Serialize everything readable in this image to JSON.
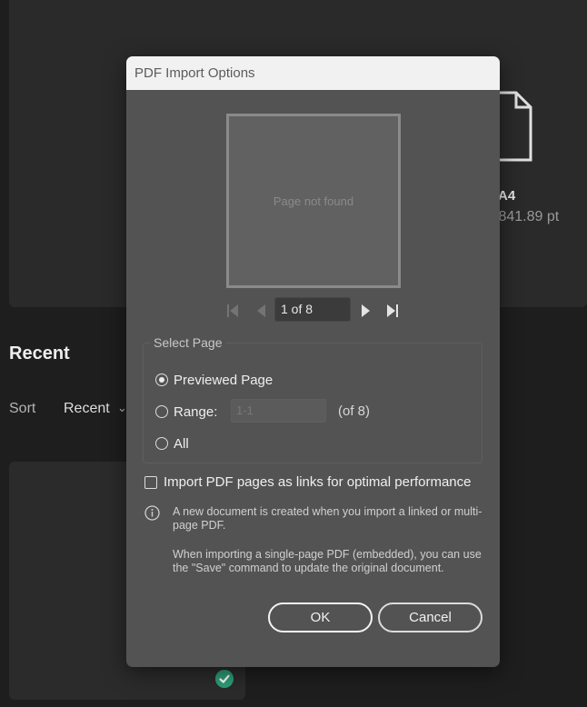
{
  "background": {
    "preset": {
      "name": "A4",
      "size_text": "x 841.89 pt"
    },
    "recent": {
      "heading": "Recent",
      "sort_label": "Sort",
      "sort_value": "Recent"
    }
  },
  "dialog": {
    "title": "PDF Import Options",
    "preview_text": "Page not found",
    "page_indicator": "1 of 8",
    "select_page": {
      "legend": "Select Page",
      "options": [
        {
          "label": "Previewed Page",
          "selected": true
        },
        {
          "label": "Range:",
          "selected": false
        },
        {
          "label": "All",
          "selected": false
        }
      ],
      "range_placeholder": "1-1",
      "range_of": "(of 8)"
    },
    "link_checkbox": {
      "label": "Import PDF pages as links for optimal performance",
      "checked": false
    },
    "info": {
      "line1": "A new document is created when you import a linked or multi-page PDF.",
      "line2": "When importing a single-page PDF (embedded), you can use the \"Save\" command to update the original document."
    },
    "buttons": {
      "ok": "OK",
      "cancel": "Cancel"
    }
  },
  "colors": {
    "dialog_bg": "#535353",
    "titlebar_bg": "#f1f1f1",
    "app_bg": "#1e1e1e",
    "badge": "#2d9d78"
  },
  "icons": [
    "first-page-icon",
    "previous-page-icon",
    "next-page-icon",
    "last-page-icon",
    "info-icon",
    "document-icon",
    "checkmark-icon"
  ]
}
